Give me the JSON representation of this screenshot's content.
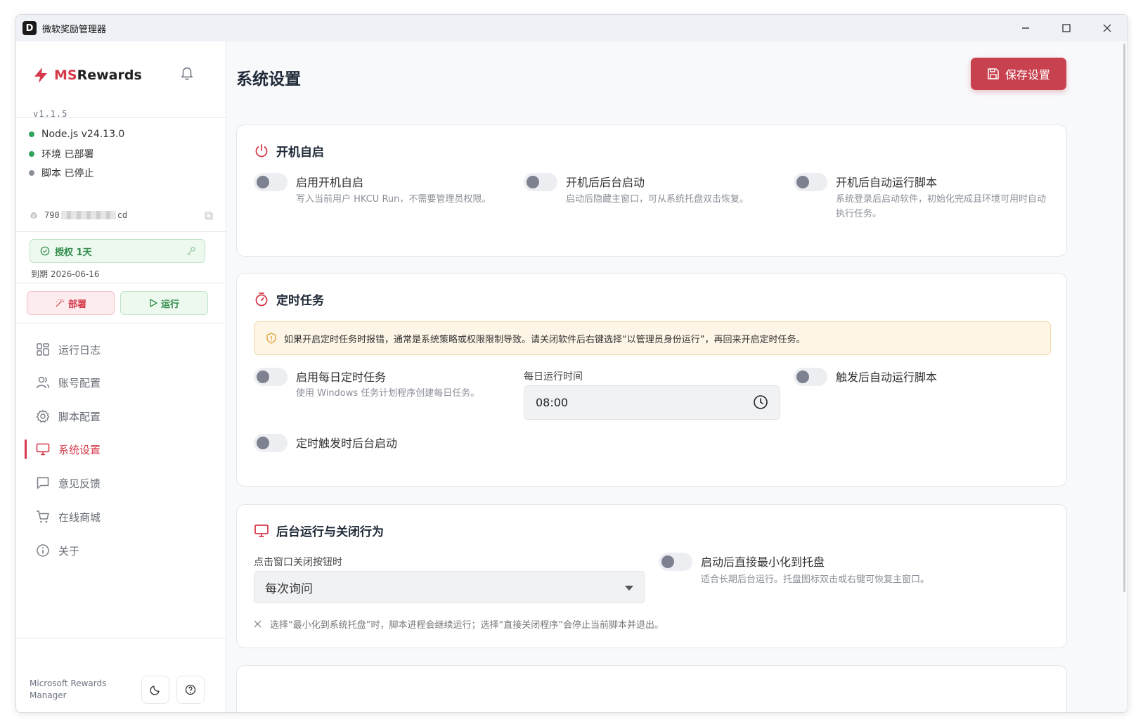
{
  "window": {
    "title": "微软奖励管理器",
    "app_icon_glyph": "D",
    "controls": {
      "minimize": "—",
      "maximize": "☐",
      "close": "✕"
    }
  },
  "sidebar": {
    "brand_prefix": "MS",
    "brand_suffix": "Rewards",
    "version": "v1.1.5",
    "status": [
      {
        "text": "Node.js v24.13.0",
        "state": "ok"
      },
      {
        "text": "环境 已部署",
        "state": "ok"
      },
      {
        "text": "脚本 已停止",
        "state": "stopped"
      }
    ],
    "machine_id_prefix": "790",
    "machine_id_suffix": "cd",
    "license_label": "授权 1天",
    "expiry": "到期 2026-06-16",
    "deploy_label": "部署",
    "run_label": "运行",
    "nav": [
      {
        "label": "运行日志",
        "icon": "grid-icon"
      },
      {
        "label": "账号配置",
        "icon": "users-icon"
      },
      {
        "label": "脚本配置",
        "icon": "gear-icon"
      },
      {
        "label": "系统设置",
        "icon": "monitor-icon",
        "active": true
      },
      {
        "label": "意见反馈",
        "icon": "message-icon"
      },
      {
        "label": "在线商城",
        "icon": "cart-icon"
      },
      {
        "label": "关于",
        "icon": "info-icon"
      }
    ],
    "footer_text": "Microsoft Rewards Manager"
  },
  "main": {
    "title": "系统设置",
    "save_label": "保存设置",
    "startup": {
      "title": "开机自启",
      "options": [
        {
          "label": "启用开机自启",
          "desc": "写入当前用户 HKCU Run，不需要管理员权限。",
          "enabled": false
        },
        {
          "label": "开机后后台启动",
          "desc": "启动后隐藏主窗口，可从系统托盘双击恢复。",
          "enabled": false
        },
        {
          "label": "开机后自动运行脚本",
          "desc": "系统登录后启动软件，初始化完成且环境可用时自动执行任务。",
          "enabled": false
        }
      ]
    },
    "schedule": {
      "title": "定时任务",
      "warning": "如果开启定时任务时报错，通常是系统策略或权限限制导致。请关闭软件后右键选择“以管理员身份运行”，再回来开启定时任务。",
      "daily_label": "启用每日定时任务",
      "daily_desc": "使用 Windows 任务计划程序创建每日任务。",
      "time_label": "每日运行时间",
      "time_value": "08:00",
      "auto_run_label": "触发后自动运行脚本",
      "background_label": "定时触发时后台启动"
    },
    "behavior": {
      "title": "后台运行与关闭行为",
      "close_label": "点击窗口关闭按钮时",
      "close_value": "每次询问",
      "minimize_label": "启动后直接最小化到托盘",
      "minimize_desc": "适合长期后台运行。托盘图标双击或右键可恢复主窗口。",
      "note": "选择“最小化到系统托盘”时，脚本进程会继续运行；选择“直接关闭程序”会停止当前脚本并退出。"
    }
  },
  "colors": {
    "accent": "#d43a4a",
    "save_button": "#c8414e",
    "success": "#2e8b48",
    "warning_bg": "#fdf5e6"
  }
}
